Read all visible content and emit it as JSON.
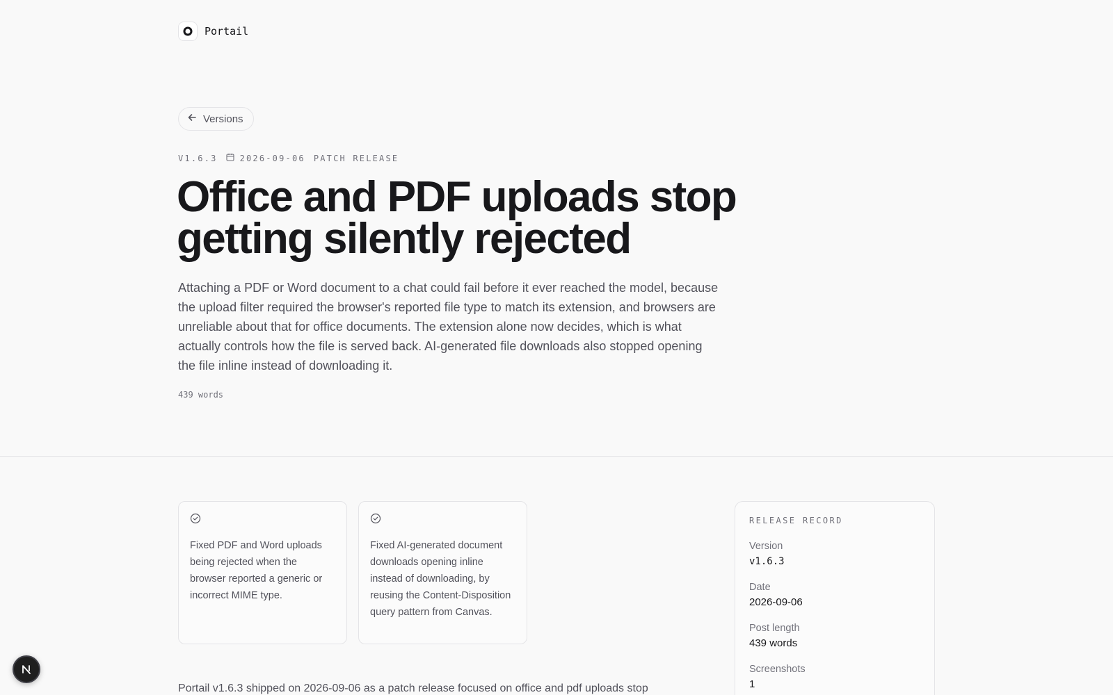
{
  "brand": {
    "name": "Portail",
    "icon": "ring-logo-icon"
  },
  "nav": {
    "back_label": "Versions",
    "back_icon": "arrow-left-icon"
  },
  "meta": {
    "version": "V1.6.3",
    "date": "2026-09-06",
    "release_type": "PATCH RELEASE",
    "date_icon": "calendar-icon"
  },
  "hero": {
    "title": "Office and PDF uploads stop getting silently rejected",
    "lede": "Attaching a PDF or Word document to a chat could fail before it ever reached the model, because the upload filter required the browser's reported file type to match its extension, and browsers are unreliable about that for office documents. The extension alone now decides, which is what actually controls how the file is served back. AI-generated file downloads also stopped opening the file inline instead of downloading it.",
    "word_count": "439 words"
  },
  "changes": [
    {
      "icon": "check-circle-icon",
      "text": "Fixed PDF and Word uploads being rejected when the browser reported a generic or incorrect MIME type."
    },
    {
      "icon": "check-circle-icon",
      "text": "Fixed AI-generated document downloads opening inline instead of downloading, by reusing the Content-Disposition query pattern from Canvas."
    }
  ],
  "record": {
    "heading": "RELEASE RECORD",
    "version_label": "Version",
    "version_value": "v1.6.3",
    "date_label": "Date",
    "date_value": "2026-09-06",
    "length_label": "Post length",
    "length_value": "439 words",
    "screenshots_label": "Screenshots",
    "screenshots_value": "1"
  },
  "body": {
    "intro": "Portail v1.6.3 shipped on 2026-09-06 as a patch release focused on office and pdf uploads stop"
  },
  "dev_badge": {
    "letter": "N"
  },
  "colors": {
    "text": "#18181b",
    "muted": "#52525b",
    "subtle": "#71717a",
    "border": "#e4e4e7",
    "background": "#f9f9f9"
  }
}
